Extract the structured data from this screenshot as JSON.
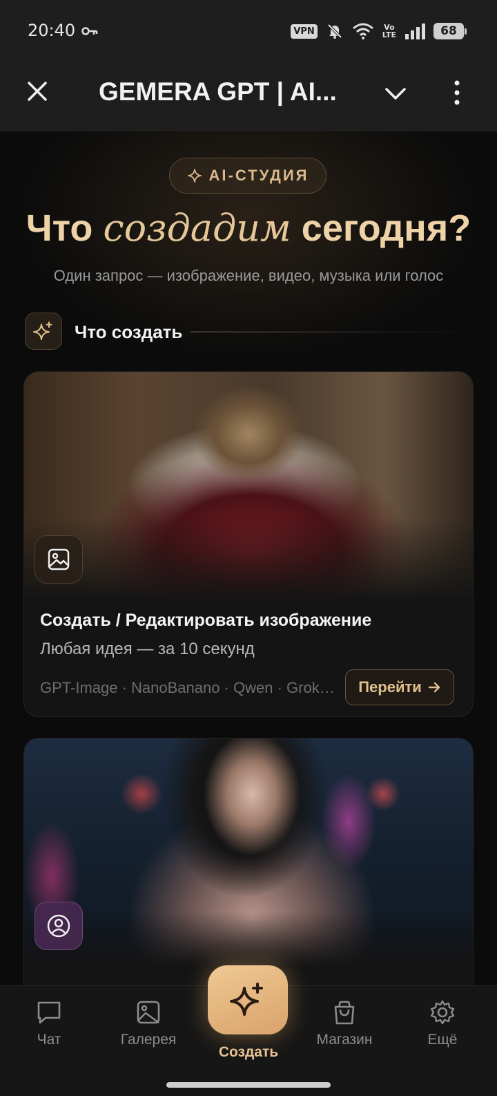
{
  "status_bar": {
    "time": "20:40",
    "vpn": "VPN",
    "volte_top": "Vo",
    "volte_bottom": "LTE",
    "battery": "68"
  },
  "header": {
    "title": "GEMERA GPT | AI..."
  },
  "hero": {
    "pill_label": "AI-СТУДИЯ",
    "headline_before": "Что ",
    "headline_accent": "создадим",
    "headline_after": " сегодня?",
    "subtitle": "Один запрос — изображение, видео, музыка или голос"
  },
  "section": {
    "title": "Что создать"
  },
  "cards": [
    {
      "title": "Создать / Редактировать изображение",
      "subtitle": "Любая идея — за 10 секунд",
      "models": "GPT-Image · NanoBanano · Qwen · Grok ...",
      "button_label": "Перейти"
    }
  ],
  "bottom_nav": {
    "items": [
      {
        "label": "Чат",
        "icon": "chat-icon"
      },
      {
        "label": "Галерея",
        "icon": "gallery-icon"
      },
      {
        "label": "Создать",
        "icon": "sparkles-icon"
      },
      {
        "label": "Магазин",
        "icon": "shopping-bag-icon"
      },
      {
        "label": "Ещё",
        "icon": "gear-icon"
      }
    ]
  },
  "colors": {
    "accent": "#e2bf8c",
    "create_button": "#e8b47a",
    "background": "#0b0b0b"
  }
}
